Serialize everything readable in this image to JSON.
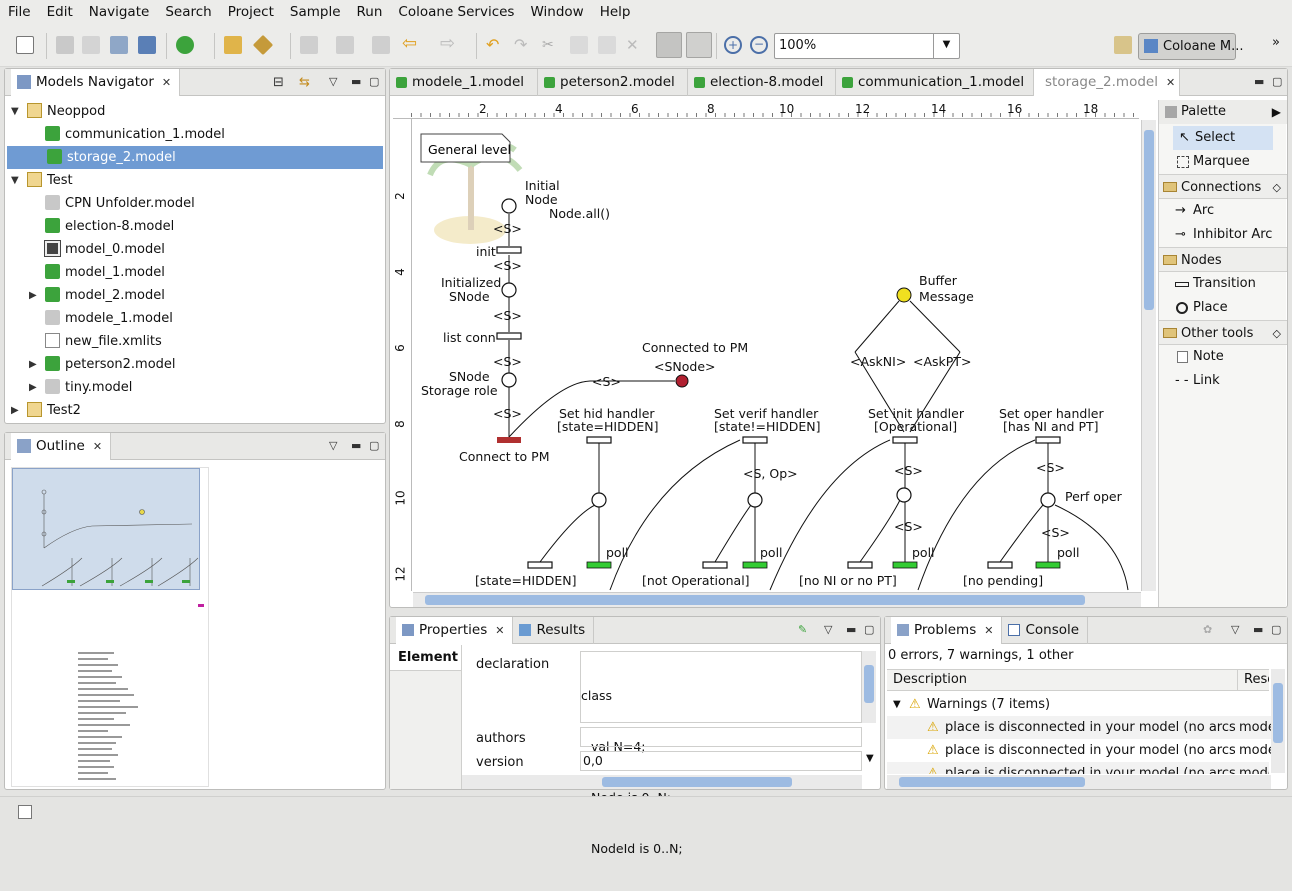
{
  "menu": [
    "File",
    "Edit",
    "Navigate",
    "Search",
    "Project",
    "Sample",
    "Run",
    "Coloane Services",
    "Window",
    "Help"
  ],
  "toolbar": {
    "zoom_value": "100%",
    "perspective_label": "Coloane M..."
  },
  "navigator": {
    "title": "Models Navigator",
    "items": [
      {
        "label": "Neoppod",
        "type": "project",
        "expanded": true
      },
      {
        "label": "communication_1.model",
        "type": "green"
      },
      {
        "label": "storage_2.model",
        "type": "green",
        "selected": true
      },
      {
        "label": "Test",
        "type": "project",
        "expanded": true
      },
      {
        "label": "CPN Unfolder.model",
        "type": "grey"
      },
      {
        "label": "election-8.model",
        "type": "green"
      },
      {
        "label": "model_0.model",
        "type": "monitor"
      },
      {
        "label": "model_1.model",
        "type": "green"
      },
      {
        "label": "model_2.model",
        "type": "green",
        "collapsed": true
      },
      {
        "label": "modele_1.model",
        "type": "grey"
      },
      {
        "label": "new_file.xmlits",
        "type": "doc"
      },
      {
        "label": "peterson2.model",
        "type": "green",
        "collapsed": true
      },
      {
        "label": "tiny.model",
        "type": "grey",
        "collapsed": true
      },
      {
        "label": "Test2",
        "type": "project",
        "collapsed": true
      }
    ]
  },
  "outline": {
    "title": "Outline"
  },
  "editor": {
    "tabs": [
      "modele_1.model",
      "peterson2.model",
      "election-8.model",
      "communication_1.model",
      "storage_2.model"
    ],
    "ruler_top": [
      "2",
      "4",
      "6",
      "8",
      "10",
      "12",
      "14",
      "16",
      "18"
    ],
    "ruler_left": [
      "2",
      "4",
      "6",
      "8",
      "10",
      "12"
    ],
    "note": "General level",
    "labels": {
      "initial": "Initial",
      "node": "Node",
      "node_all": "Node.all()",
      "s": "<S>",
      "init": "init",
      "initialized": "Initialized",
      "snode": "SNode",
      "list_conn": "list conn",
      "snode2": "SNode",
      "storage_role": "Storage role",
      "connect_pm": "Connect to PM",
      "connected_pm": "Connected to PM",
      "snode_tag": "<SNode>",
      "buffer": "Buffer",
      "message": "Message",
      "askni": "<AskNI>",
      "askpt": "<AskPT>",
      "hid1": "Set hid handler",
      "hid2": "[state=HIDDEN]",
      "verif1": "Set verif handler",
      "verif2": "[state!=HIDDEN]",
      "inith1": "Set init handler",
      "inith2": "[Operational]",
      "oper1": "Set oper handler",
      "oper2": "[has NI and PT]",
      "sop": "<S, Op>",
      "perf": "Perf oper",
      "poll": "poll",
      "g1": "[state=HIDDEN]",
      "g2": "[not Operational]",
      "g3": "[no NI or no PT]",
      "g4": "[no pending]"
    }
  },
  "palette": {
    "title": "Palette",
    "select": "Select",
    "marquee": "Marquee",
    "connections": "Connections",
    "arc": "Arc",
    "inhibitor": "Inhibitor Arc",
    "nodes": "Nodes",
    "transition": "Transition",
    "place": "Place",
    "other": "Other tools",
    "note": "Note",
    "link": "Link"
  },
  "properties": {
    "tabs": [
      "Properties",
      "Results"
    ],
    "section": "Element",
    "rows": [
      {
        "label": "declaration"
      },
      {
        "label": "authors"
      },
      {
        "label": "version"
      }
    ],
    "declaration_lines": [
      "class",
      "val N=4;",
      "Node is 0..N;",
      "NodeId is 0..N;"
    ],
    "authors_value": "",
    "version_value": "0,0"
  },
  "problems": {
    "tabs": [
      "Problems",
      "Console"
    ],
    "summary": "0 errors, 7 warnings, 1 other",
    "col_desc": "Description",
    "col_res": "Resou",
    "group": "Warnings (7 items)",
    "items": [
      {
        "text": "place is disconnected in your model (no arcs to o",
        "res": "mode"
      },
      {
        "text": "place is disconnected in your model (no arcs to o",
        "res": "mode"
      },
      {
        "text": "place is disconnected in your model (no arcs to o",
        "res": "mode"
      }
    ]
  }
}
